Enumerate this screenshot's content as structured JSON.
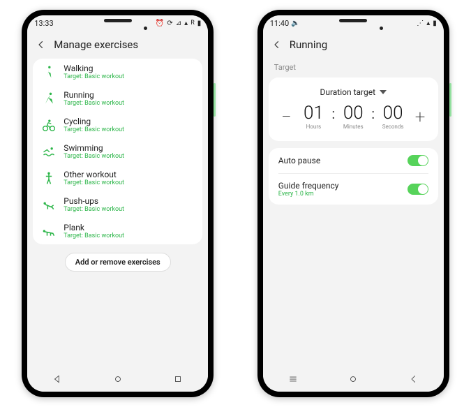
{
  "left_phone": {
    "status": {
      "time": "13:33",
      "icons": [
        "alarm",
        "sync",
        "signal",
        "R",
        "battery"
      ]
    },
    "header": {
      "title": "Manage exercises"
    },
    "exercises": [
      {
        "name": "Walking",
        "target": "Target: Basic workout",
        "icon": "walking"
      },
      {
        "name": "Running",
        "target": "Target: Basic workout",
        "icon": "running"
      },
      {
        "name": "Cycling",
        "target": "Target: Basic workout",
        "icon": "cycling"
      },
      {
        "name": "Swimming",
        "target": "Target: Basic workout",
        "icon": "swimming"
      },
      {
        "name": "Other workout",
        "target": "Target: Basic workout",
        "icon": "other"
      },
      {
        "name": "Push-ups",
        "target": "Target: Basic workout",
        "icon": "pushups"
      },
      {
        "name": "Plank",
        "target": "Target: Basic workout",
        "icon": "plank"
      }
    ],
    "add_button_label": "Add or remove exercises"
  },
  "right_phone": {
    "status": {
      "time": "11:40",
      "icons": [
        "volume",
        "wifi",
        "signal",
        "battery"
      ]
    },
    "header": {
      "title": "Running"
    },
    "section_label": "Target",
    "target_dropdown": "Duration target",
    "time": {
      "hours": {
        "value": "01",
        "label": "Hours"
      },
      "minutes": {
        "value": "00",
        "label": "Minutes"
      },
      "seconds": {
        "value": "00",
        "label": "Seconds"
      }
    },
    "settings": {
      "auto_pause": {
        "title": "Auto pause",
        "on": true
      },
      "guide_frequency": {
        "title": "Guide frequency",
        "sub": "Every 1.0 km",
        "on": true
      }
    }
  }
}
